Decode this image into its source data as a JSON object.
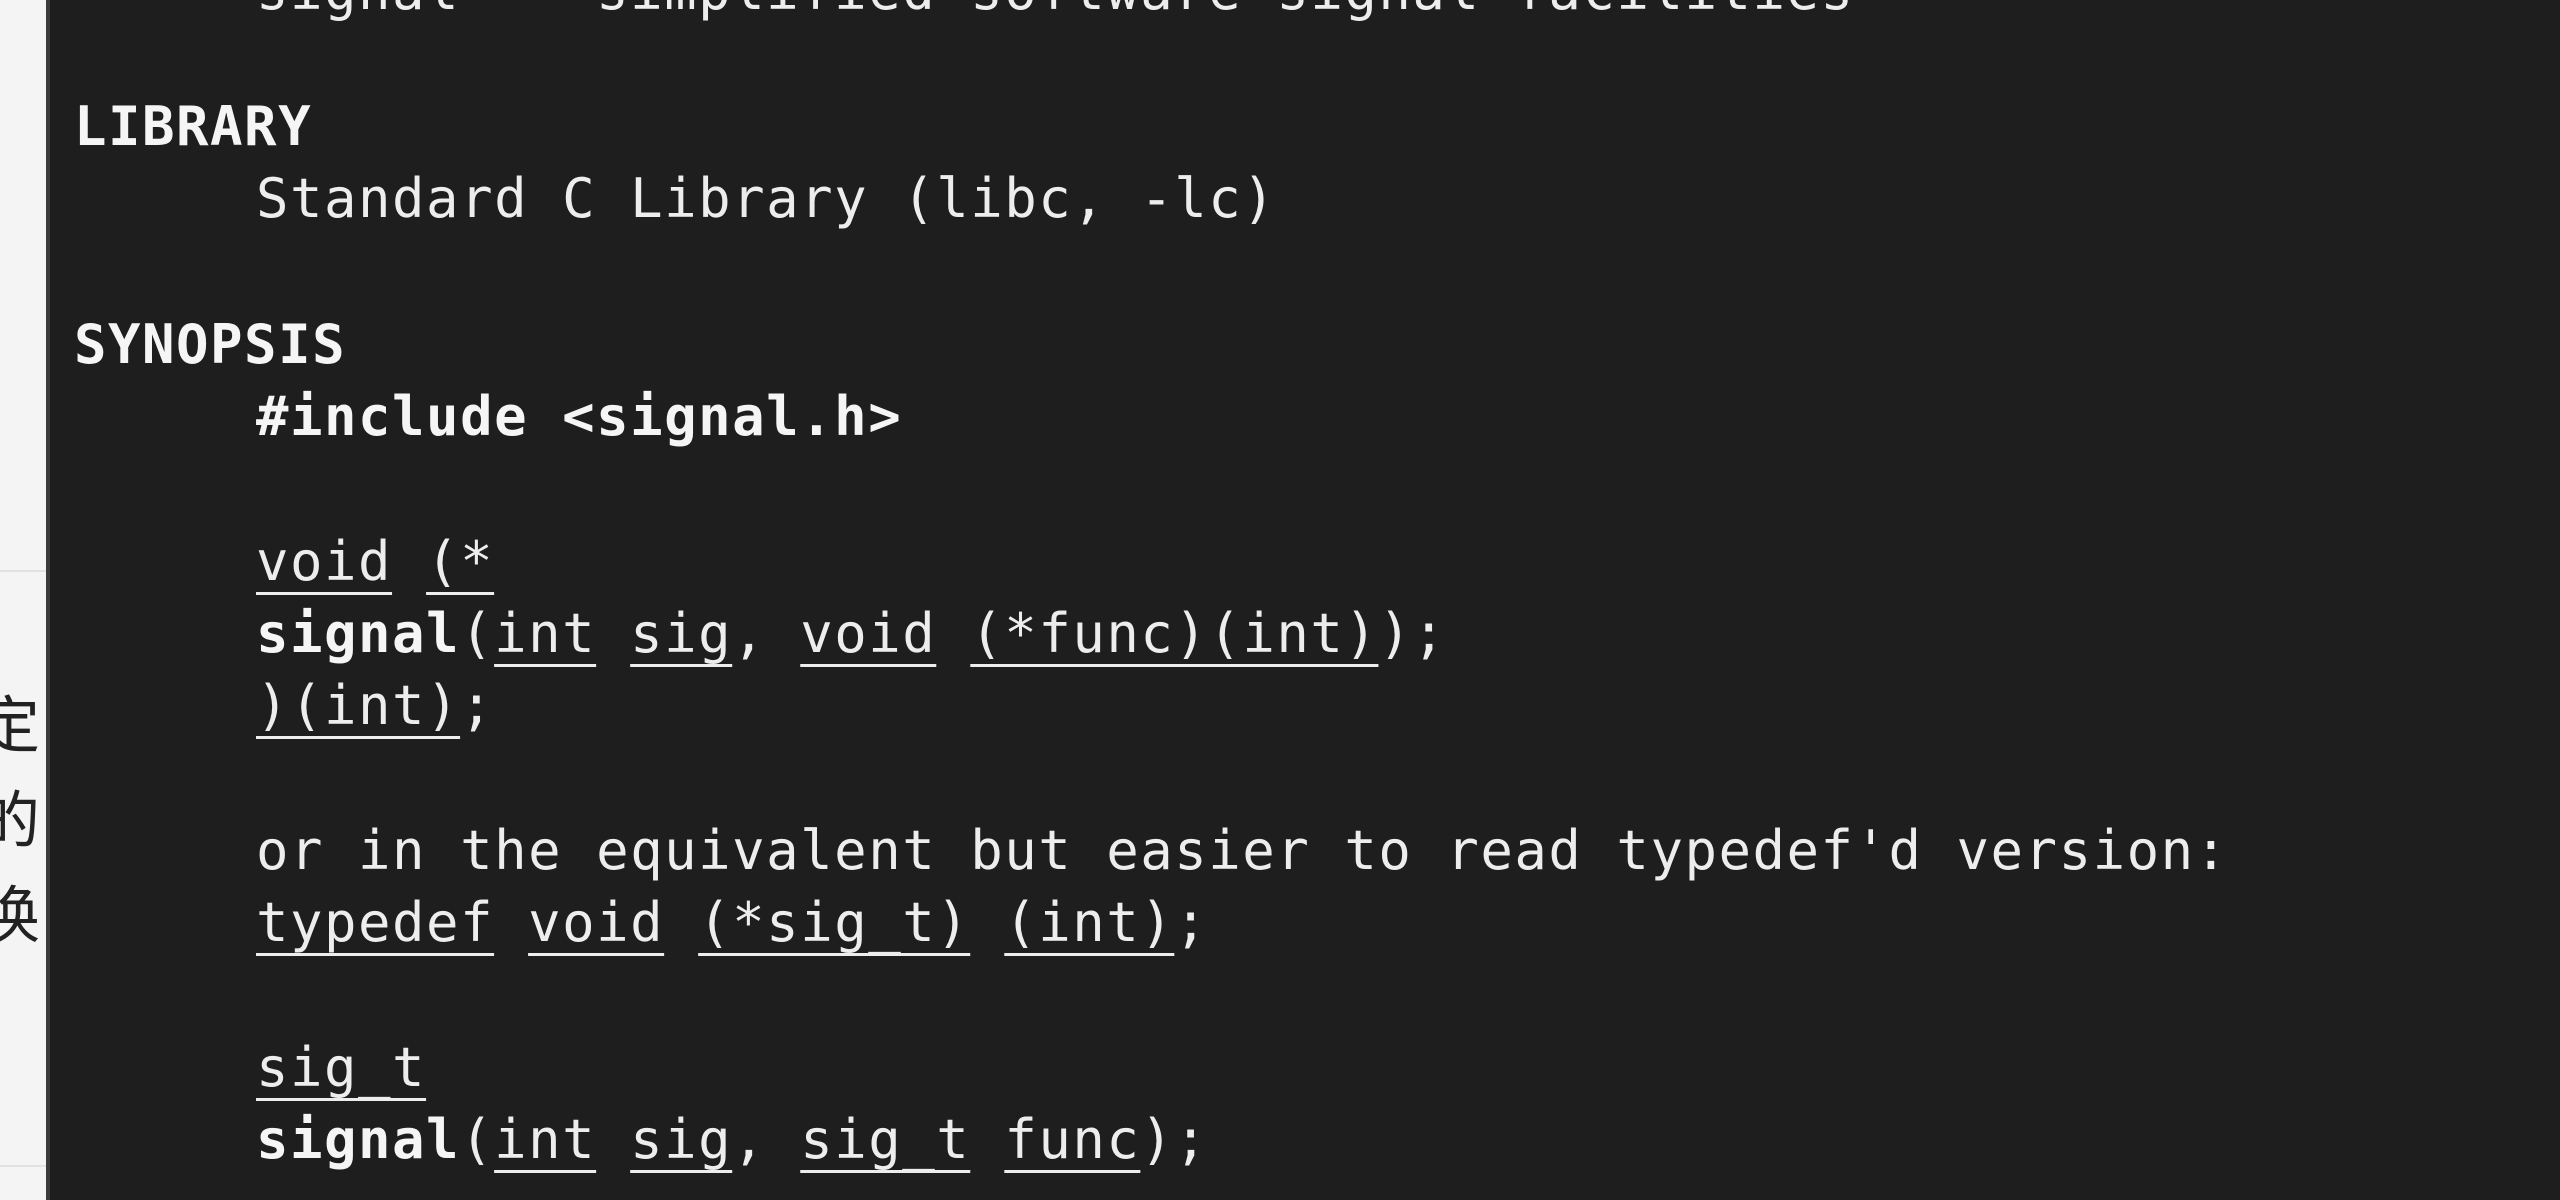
{
  "background_document": {
    "chars": [
      "定",
      "的",
      "换"
    ]
  },
  "terminal": {
    "top_cutoff_text": "signal -- simplified software signal facilities",
    "sections": {
      "library": {
        "heading": "LIBRARY",
        "text": "Standard C Library (libc, -lc)"
      },
      "synopsis": {
        "heading": "SYNOPSIS",
        "include": "#include <signal.h>",
        "proto1": {
          "l1_a": "void",
          "l1_b": "(*",
          "l2_fn": "signal",
          "l2_open": "(",
          "l2_t1": "int",
          "l2_p1": "sig",
          "l2_comma": ", ",
          "l2_t2": "void",
          "l2_p2": "(*func)(int)",
          "l2_close": ");",
          "l3_a": ")(int)",
          "l3_b": ";"
        },
        "note": "or in the equivalent but easier to read typedef'd version:",
        "typedef_line": {
          "kw": "typedef",
          "t": "void",
          "name": "(*sig_t)",
          "args": "(int)",
          "end": ";"
        },
        "proto2": {
          "l1": "sig_t",
          "l2_fn": "signal",
          "l2_open": "(",
          "l2_t1": "int",
          "l2_p1": "sig",
          "l2_comma": ", ",
          "l2_t2": "sig_t",
          "l2_p2": "func",
          "l2_close": ");"
        }
      }
    }
  }
}
